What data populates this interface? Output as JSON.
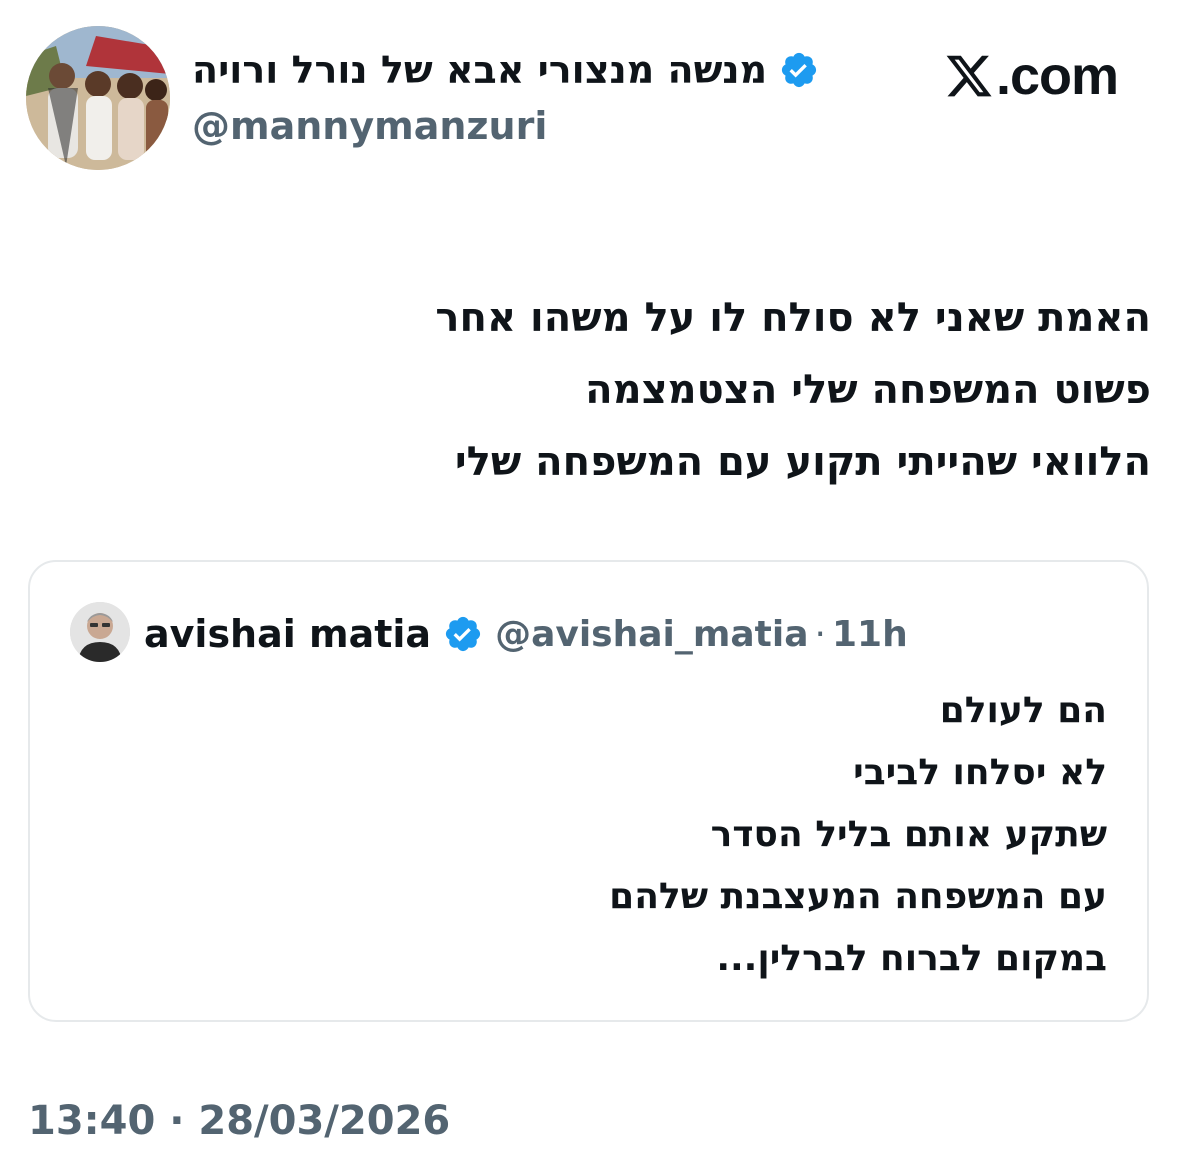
{
  "author": {
    "display_name": "מנשה מנצורי אבא של נורל ורויה",
    "handle": "@mannymanzuri",
    "verified": true
  },
  "site": {
    "logo": "x-logo-icon",
    "domain": ".com"
  },
  "tweet": {
    "lines": [
      "האמת שאני לא סולח לו על משהו אחר",
      "פשוט המשפחה שלי הצטמצמה",
      "הלוואי שהייתי תקוע עם המשפחה שלי"
    ]
  },
  "quoted": {
    "display_name": "avishai matia",
    "handle": "@avishai_matia",
    "separator": "·",
    "time": "11h",
    "verified": true,
    "lines": [
      "הם לעולם",
      "לא יסלחו לביבי",
      "שתקע אותם בליל הסדר",
      "עם המשפחה המעצבנת שלהם",
      "במקום לברוח לברלין..."
    ]
  },
  "footer": {
    "timestamp": "13:40 · 28/03/2026"
  },
  "colors": {
    "text_primary": "#0f1419",
    "text_secondary": "#536471",
    "verified_blue": "#1d9bf0",
    "card_border": "#e6e9eb"
  }
}
